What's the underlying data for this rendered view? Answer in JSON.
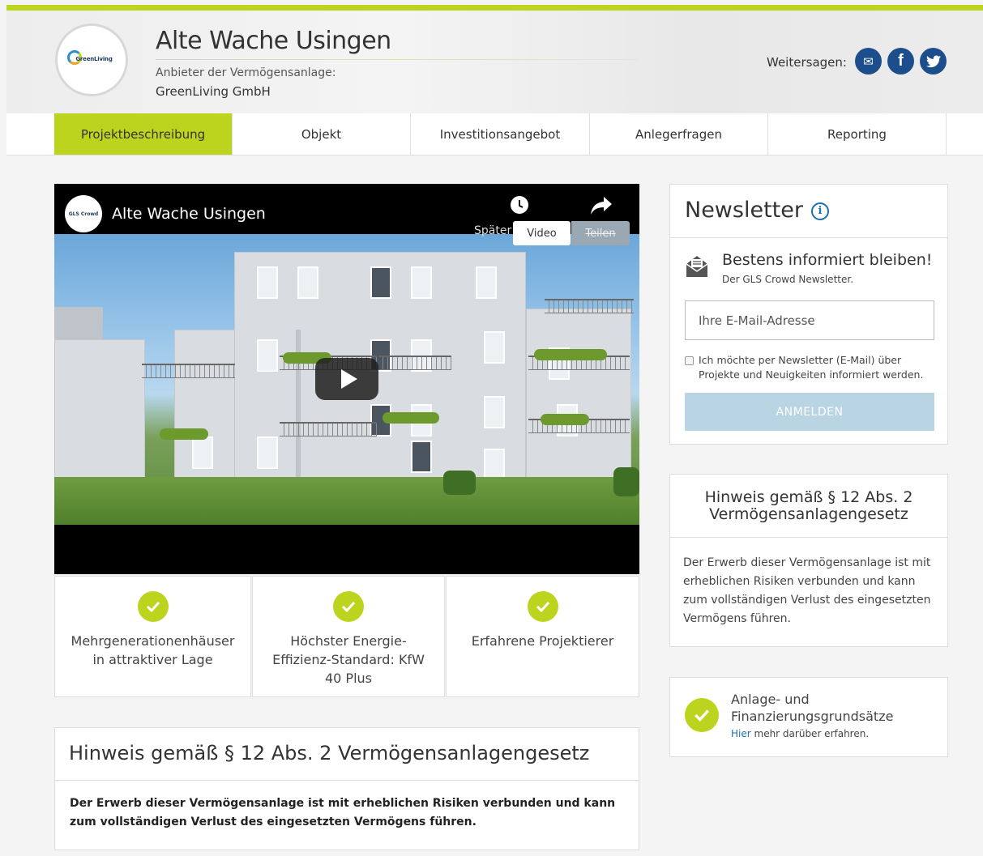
{
  "header": {
    "logo_text": "GreenLiving",
    "title": "Alte Wache Usingen",
    "provider_label": "Anbieter der Vermögensanlage:",
    "provider_name": "GreenLiving GmbH",
    "share_label": "Weitersagen:",
    "share_buttons": [
      {
        "icon": "mail-icon",
        "glyph": "✉"
      },
      {
        "icon": "facebook-icon",
        "glyph": "f"
      },
      {
        "icon": "twitter-icon",
        "glyph": "t"
      }
    ]
  },
  "tabs": [
    {
      "label": "Projektbeschreibung",
      "active": true
    },
    {
      "label": "Objekt",
      "active": false
    },
    {
      "label": "Investitionsangebot",
      "active": false
    },
    {
      "label": "Anlegerfragen",
      "active": false
    },
    {
      "label": "Reporting",
      "active": false
    }
  ],
  "video": {
    "channel_badge": "GLS Crowd",
    "title": "Alte Wache Usingen",
    "later_label": "Später",
    "share_label": "Teilen",
    "tooltip": "Video"
  },
  "features": [
    {
      "text": "Mehrgenerationenhäuser in attraktiver Lage"
    },
    {
      "text": "Höchster Energie-Effizienz-Standard: KfW 40 Plus"
    },
    {
      "text": "Erfahrene Projektierer"
    }
  ],
  "hinweis_main": {
    "title": "Hinweis gemäß § 12 Abs. 2 Vermögensanlagengesetz",
    "text": "Der Erwerb dieser Vermögensanlage ist mit erheblichen Risiken verbunden und kann zum vollständigen Verlust des eingesetzten Vermögens führen."
  },
  "newsletter": {
    "title": "Newsletter",
    "headline": "Bestens informiert bleiben!",
    "subline": "Der GLS Crowd Newsletter.",
    "email_placeholder": "Ihre E-Mail-Adresse",
    "consent_text": "Ich möchte per Newsletter (E-Mail) über Projekte und Neuigkeiten informiert werden.",
    "button_label": "ANMELDEN"
  },
  "hinweis_side": {
    "title": "Hinweis gemäß § 12 Abs. 2 Vermögensanlagengesetz",
    "text": "Der Erwerb dieser Vermögensanlage ist mit erheblichen Risiken verbunden und kann zum vollständigen Verlust des eingesetzten Vermögens führen."
  },
  "anlage": {
    "title": "Anlage- und Finanzierungsgrundsätze",
    "link_label": "Hier",
    "link_suffix": " mehr darüber erfahren."
  },
  "colors": {
    "accent": "#bdd41f",
    "brand_blue": "#1c4e8c",
    "button_disabled": "#b9d4e3"
  }
}
